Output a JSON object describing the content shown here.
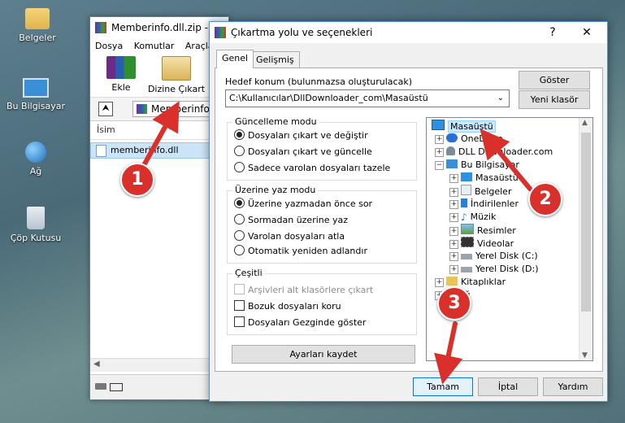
{
  "desktop": {
    "icons": [
      {
        "label": "Belgeler"
      },
      {
        "label": "Bu Bilgisayar"
      },
      {
        "label": "Ağ"
      },
      {
        "label": "Çöp Kutusu"
      }
    ]
  },
  "winrar": {
    "title": "Memberinfo.dll.zip -",
    "menu": [
      "Dosya",
      "Komutlar",
      "Araçla"
    ],
    "toolbar": {
      "add": "Ekle",
      "extract": "Dizine Çıkart"
    },
    "address": "Memberinfo.dll",
    "column": "İsim",
    "file": "memberinfo.dll"
  },
  "dialog": {
    "title": "Çıkartma yolu ve seçenekleri",
    "help_btn": "?",
    "close_btn": "✕",
    "tabs": [
      "Genel",
      "Gelişmiş"
    ],
    "dest_label": "Hedef konum (bulunmazsa oluşturulacak)",
    "dest_value": "C:\\Kullanıcılar\\DllDownloader_com\\Masaüstü",
    "show_btn": "Göster",
    "newfolder_btn": "Yeni klasör",
    "update_group": {
      "title": "Güncelleme modu",
      "options": [
        "Dosyaları çıkart ve değiştir",
        "Dosyaları çıkart ve güncelle",
        "Sadece varolan dosyaları tazele"
      ]
    },
    "overwrite_group": {
      "title": "Üzerine yaz modu",
      "options": [
        "Üzerine yazmadan önce sor",
        "Sormadan üzerine yaz",
        "Varolan dosyaları atla",
        "Otomatik yeniden adlandır"
      ]
    },
    "misc_group": {
      "title": "Çeşitli",
      "options": [
        "Arşivleri alt klasörlere çıkart",
        "Bozuk dosyaları koru",
        "Dosyaları Gezginde göster"
      ]
    },
    "save_btn": "Ayarları kaydet",
    "tree": [
      "Masaüstü",
      "OneDrive",
      "DLL Downloader.com",
      "Bu Bilgisayar",
      "Masaüstü",
      "Belgeler",
      "İndirilenler",
      "Müzik",
      "Resimler",
      "Videolar",
      "Yerel Disk (C:)",
      "Yerel Disk (D:)",
      "Kitaplıklar",
      "Ağ"
    ],
    "ok_btn": "Tamam",
    "cancel_btn": "İptal",
    "help_button": "Yardım"
  },
  "annotations": [
    "1",
    "2",
    "3"
  ],
  "colors": {
    "accent": "#d9302c",
    "selection": "#cce8ff",
    "border": "#4a90d9"
  }
}
